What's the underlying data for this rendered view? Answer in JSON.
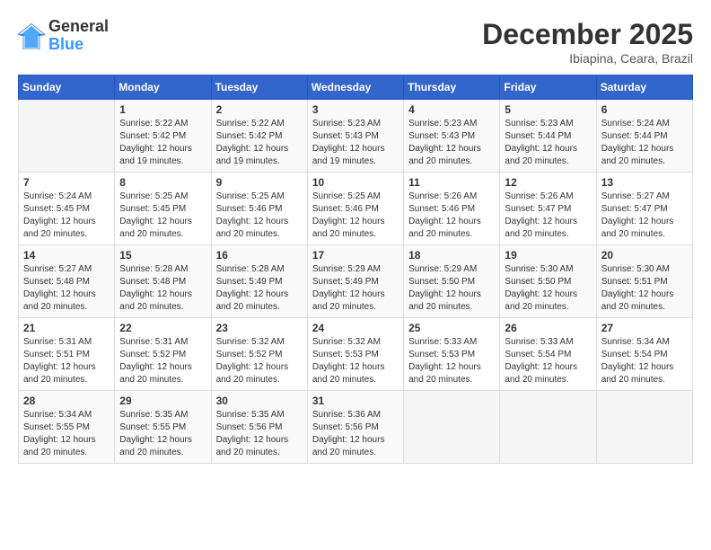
{
  "header": {
    "logo_line1": "General",
    "logo_line2": "Blue",
    "month_year": "December 2025",
    "location": "Ibiapina, Ceara, Brazil"
  },
  "calendar": {
    "days_of_week": [
      "Sunday",
      "Monday",
      "Tuesday",
      "Wednesday",
      "Thursday",
      "Friday",
      "Saturday"
    ],
    "weeks": [
      [
        {
          "day": "",
          "info": ""
        },
        {
          "day": "1",
          "info": "Sunrise: 5:22 AM\nSunset: 5:42 PM\nDaylight: 12 hours\nand 19 minutes."
        },
        {
          "day": "2",
          "info": "Sunrise: 5:22 AM\nSunset: 5:42 PM\nDaylight: 12 hours\nand 19 minutes."
        },
        {
          "day": "3",
          "info": "Sunrise: 5:23 AM\nSunset: 5:43 PM\nDaylight: 12 hours\nand 19 minutes."
        },
        {
          "day": "4",
          "info": "Sunrise: 5:23 AM\nSunset: 5:43 PM\nDaylight: 12 hours\nand 20 minutes."
        },
        {
          "day": "5",
          "info": "Sunrise: 5:23 AM\nSunset: 5:44 PM\nDaylight: 12 hours\nand 20 minutes."
        },
        {
          "day": "6",
          "info": "Sunrise: 5:24 AM\nSunset: 5:44 PM\nDaylight: 12 hours\nand 20 minutes."
        }
      ],
      [
        {
          "day": "7",
          "info": "Sunrise: 5:24 AM\nSunset: 5:45 PM\nDaylight: 12 hours\nand 20 minutes."
        },
        {
          "day": "8",
          "info": "Sunrise: 5:25 AM\nSunset: 5:45 PM\nDaylight: 12 hours\nand 20 minutes."
        },
        {
          "day": "9",
          "info": "Sunrise: 5:25 AM\nSunset: 5:46 PM\nDaylight: 12 hours\nand 20 minutes."
        },
        {
          "day": "10",
          "info": "Sunrise: 5:25 AM\nSunset: 5:46 PM\nDaylight: 12 hours\nand 20 minutes."
        },
        {
          "day": "11",
          "info": "Sunrise: 5:26 AM\nSunset: 5:46 PM\nDaylight: 12 hours\nand 20 minutes."
        },
        {
          "day": "12",
          "info": "Sunrise: 5:26 AM\nSunset: 5:47 PM\nDaylight: 12 hours\nand 20 minutes."
        },
        {
          "day": "13",
          "info": "Sunrise: 5:27 AM\nSunset: 5:47 PM\nDaylight: 12 hours\nand 20 minutes."
        }
      ],
      [
        {
          "day": "14",
          "info": "Sunrise: 5:27 AM\nSunset: 5:48 PM\nDaylight: 12 hours\nand 20 minutes."
        },
        {
          "day": "15",
          "info": "Sunrise: 5:28 AM\nSunset: 5:48 PM\nDaylight: 12 hours\nand 20 minutes."
        },
        {
          "day": "16",
          "info": "Sunrise: 5:28 AM\nSunset: 5:49 PM\nDaylight: 12 hours\nand 20 minutes."
        },
        {
          "day": "17",
          "info": "Sunrise: 5:29 AM\nSunset: 5:49 PM\nDaylight: 12 hours\nand 20 minutes."
        },
        {
          "day": "18",
          "info": "Sunrise: 5:29 AM\nSunset: 5:50 PM\nDaylight: 12 hours\nand 20 minutes."
        },
        {
          "day": "19",
          "info": "Sunrise: 5:30 AM\nSunset: 5:50 PM\nDaylight: 12 hours\nand 20 minutes."
        },
        {
          "day": "20",
          "info": "Sunrise: 5:30 AM\nSunset: 5:51 PM\nDaylight: 12 hours\nand 20 minutes."
        }
      ],
      [
        {
          "day": "21",
          "info": "Sunrise: 5:31 AM\nSunset: 5:51 PM\nDaylight: 12 hours\nand 20 minutes."
        },
        {
          "day": "22",
          "info": "Sunrise: 5:31 AM\nSunset: 5:52 PM\nDaylight: 12 hours\nand 20 minutes."
        },
        {
          "day": "23",
          "info": "Sunrise: 5:32 AM\nSunset: 5:52 PM\nDaylight: 12 hours\nand 20 minutes."
        },
        {
          "day": "24",
          "info": "Sunrise: 5:32 AM\nSunset: 5:53 PM\nDaylight: 12 hours\nand 20 minutes."
        },
        {
          "day": "25",
          "info": "Sunrise: 5:33 AM\nSunset: 5:53 PM\nDaylight: 12 hours\nand 20 minutes."
        },
        {
          "day": "26",
          "info": "Sunrise: 5:33 AM\nSunset: 5:54 PM\nDaylight: 12 hours\nand 20 minutes."
        },
        {
          "day": "27",
          "info": "Sunrise: 5:34 AM\nSunset: 5:54 PM\nDaylight: 12 hours\nand 20 minutes."
        }
      ],
      [
        {
          "day": "28",
          "info": "Sunrise: 5:34 AM\nSunset: 5:55 PM\nDaylight: 12 hours\nand 20 minutes."
        },
        {
          "day": "29",
          "info": "Sunrise: 5:35 AM\nSunset: 5:55 PM\nDaylight: 12 hours\nand 20 minutes."
        },
        {
          "day": "30",
          "info": "Sunrise: 5:35 AM\nSunset: 5:56 PM\nDaylight: 12 hours\nand 20 minutes."
        },
        {
          "day": "31",
          "info": "Sunrise: 5:36 AM\nSunset: 5:56 PM\nDaylight: 12 hours\nand 20 minutes."
        },
        {
          "day": "",
          "info": ""
        },
        {
          "day": "",
          "info": ""
        },
        {
          "day": "",
          "info": ""
        }
      ]
    ]
  }
}
